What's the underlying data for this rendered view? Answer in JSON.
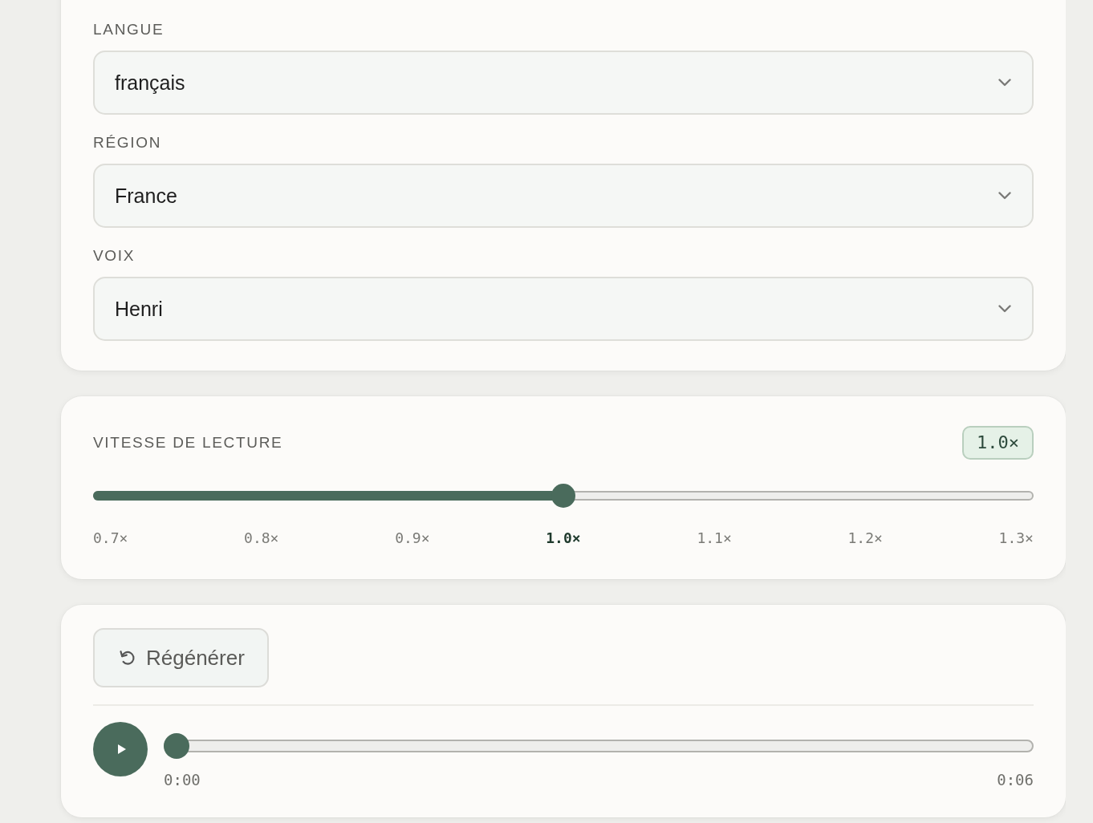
{
  "fields": [
    {
      "label": "LANGUE",
      "value": "français"
    },
    {
      "label": "RÉGION",
      "value": "France"
    },
    {
      "label": "VOIX",
      "value": "Henri"
    }
  ],
  "speed": {
    "label": "VITESSE DE LECTURE",
    "badge": "1.0×",
    "level": 0.5,
    "ticks": [
      {
        "label": "0.7×",
        "selected": false
      },
      {
        "label": "0.8×",
        "selected": false
      },
      {
        "label": "0.9×",
        "selected": false
      },
      {
        "label": "1.0×",
        "selected": true
      },
      {
        "label": "1.1×",
        "selected": false
      },
      {
        "label": "1.2×",
        "selected": false
      },
      {
        "label": "1.3×",
        "selected": false
      }
    ]
  },
  "player": {
    "regenerate": "Régénérer",
    "level": 0,
    "current": "0:00",
    "duration": "0:06"
  }
}
